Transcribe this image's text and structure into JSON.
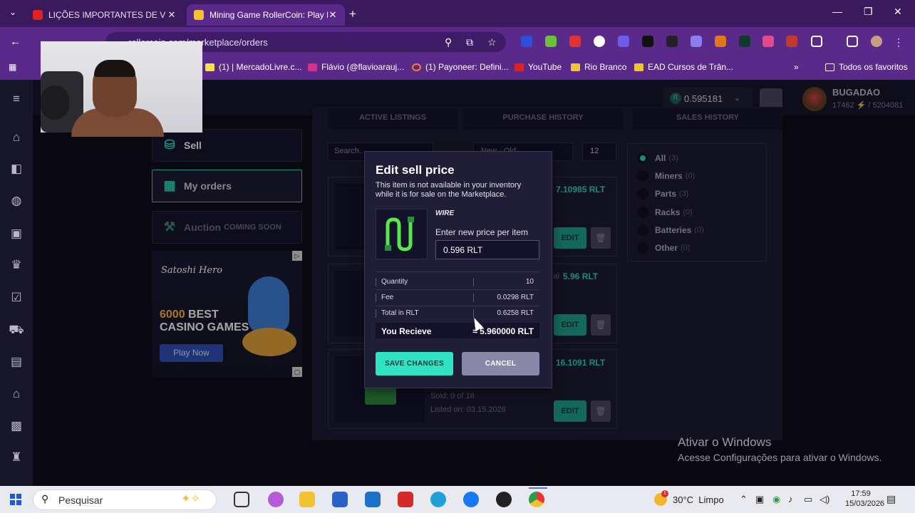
{
  "browser": {
    "tabs": [
      {
        "title": "LIÇÕES IMPORTANTES DE V",
        "favicon_color": "#e12020"
      },
      {
        "title": "Mining Game RollerCoin: Play M",
        "favicon_color": "#f5c030"
      }
    ],
    "url": "rollercoin.com/marketplace/orders",
    "bookmarks": [
      "(1) | MercadoLivre.c...",
      "Flávio (@flavioarauj...",
      "(1) Payoneer: Defini...",
      "YouTube",
      "Rio Branco",
      "EAD Cursos de Trân...",
      "Todos os favoritos"
    ]
  },
  "header": {
    "balance_symbol": "R",
    "balance": "0.595181",
    "username": "BUGADAO",
    "user_stats": "17462 ⚡ / 5204081"
  },
  "menu": {
    "sell": "Sell",
    "my_orders": "My orders",
    "auction": "Auction",
    "auction_badge": "COMING SOON"
  },
  "ad": {
    "brand": "Satoshi Hero",
    "line1_number": "6000",
    "line1_text": "BEST",
    "line2": "CASINO GAMES",
    "button": "Play Now"
  },
  "marketplace": {
    "tabs": [
      "ACTIVE LISTINGS",
      "PURCHASE HISTORY",
      "SALES HISTORY"
    ],
    "search_placeholder": "Search...",
    "sort": "New - Old",
    "per_page": "12",
    "cards": [
      {
        "price": "7.10985 RLT"
      },
      {
        "price_label": "al",
        "price": "5.96 RLT"
      },
      {
        "price": "16.1091 RLT",
        "sold": "Sold: 0 of 18",
        "listed": "Listed on: 03.15.2026"
      }
    ],
    "edit_label": "EDIT",
    "filters": [
      {
        "label": "All",
        "count": "(3)",
        "selected": true
      },
      {
        "label": "Miners",
        "count": "(0)",
        "selected": false
      },
      {
        "label": "Parts",
        "count": "(3)",
        "selected": false
      },
      {
        "label": "Racks",
        "count": "(0)",
        "selected": false
      },
      {
        "label": "Batteries",
        "count": "(0)",
        "selected": false
      },
      {
        "label": "Other",
        "count": "(0)",
        "selected": false
      }
    ]
  },
  "modal": {
    "title": "Edit sell price",
    "description": "This item is not available in your inventory while it is for sale on the Marketplace.",
    "item_name": "WIRE",
    "price_label": "Enter new price per item",
    "price_value": "0.596  RLT",
    "rows": [
      {
        "label": "Quantity",
        "value": "10"
      },
      {
        "label": "Fee",
        "value": "0.0298 RLT"
      },
      {
        "label": "Total in RLT",
        "value": "0.6258 RLT"
      }
    ],
    "receive_label": "You Recieve",
    "receive_value": "≈ 5.960000 RLT",
    "save": "SAVE CHANGES",
    "cancel": "CANCEL"
  },
  "watermark": {
    "line1": "Ativar o Windows",
    "line2": "Acesse Configurações para ativar o Windows."
  },
  "taskbar": {
    "search": "Pesquisar",
    "weather_temp": "30°C",
    "weather_text": "Limpo",
    "time": "17:59",
    "date": "15/03/2026",
    "weather_alert": "1"
  },
  "colors": {
    "accent": "#2ad6ba",
    "browser_frame": "#5a2a8a",
    "page_bg": "#0e0d1a"
  }
}
